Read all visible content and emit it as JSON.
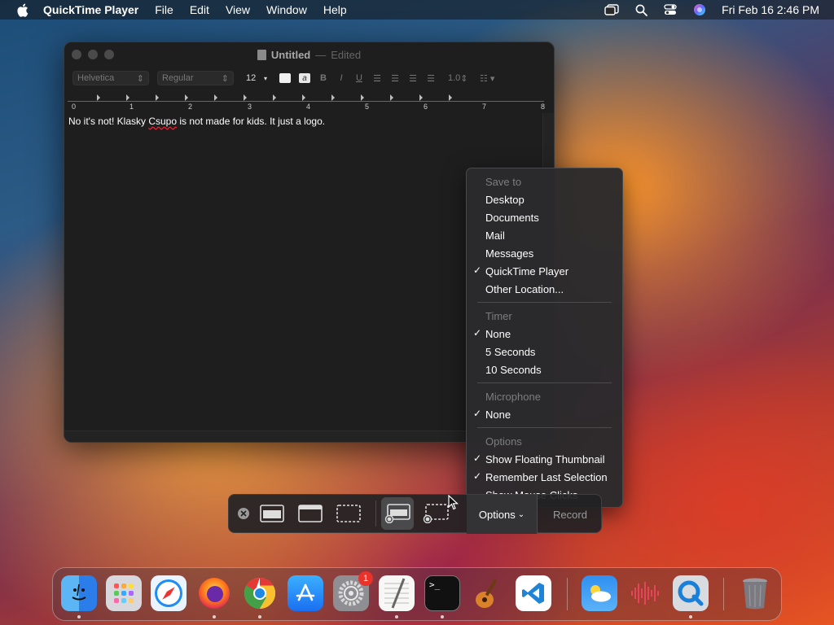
{
  "menubar": {
    "app_name": "QuickTime Player",
    "items": [
      "File",
      "Edit",
      "View",
      "Window",
      "Help"
    ],
    "clock": "Fri Feb 16  2:46 PM"
  },
  "textedit": {
    "title": "Untitled",
    "title_separator": "—",
    "edited": "Edited",
    "font_family": "Helvetica",
    "font_style": "Regular",
    "font_size": "12",
    "bold_btn": "B",
    "italic_btn": "I",
    "underline_btn": "U",
    "line_spacing": "1.0",
    "ruler_numbers": [
      "0",
      "1",
      "2",
      "3",
      "4",
      "5",
      "6",
      "7",
      "8"
    ],
    "body_text_before": "No it's not! Klasky ",
    "body_text_misspelled": "Csupo",
    "body_text_after": " is not made for kids. It just a logo."
  },
  "options_menu": {
    "sections": [
      {
        "header": "Save to",
        "items": [
          {
            "label": "Desktop",
            "checked": false
          },
          {
            "label": "Documents",
            "checked": false
          },
          {
            "label": "Mail",
            "checked": false
          },
          {
            "label": "Messages",
            "checked": false
          },
          {
            "label": "QuickTime Player",
            "checked": true
          },
          {
            "label": "Other Location...",
            "checked": false
          }
        ]
      },
      {
        "header": "Timer",
        "items": [
          {
            "label": "None",
            "checked": true
          },
          {
            "label": "5 Seconds",
            "checked": false
          },
          {
            "label": "10 Seconds",
            "checked": false
          }
        ]
      },
      {
        "header": "Microphone",
        "items": [
          {
            "label": "None",
            "checked": true
          }
        ]
      },
      {
        "header": "Options",
        "items": [
          {
            "label": "Show Floating Thumbnail",
            "checked": true
          },
          {
            "label": "Remember Last Selection",
            "checked": true
          },
          {
            "label": "Show Mouse Clicks",
            "checked": false
          }
        ]
      }
    ]
  },
  "capture_bar": {
    "options_label": "Options",
    "record_label": "Record"
  },
  "dock": {
    "settings_badge": "1",
    "terminal_prompt": ">_"
  }
}
